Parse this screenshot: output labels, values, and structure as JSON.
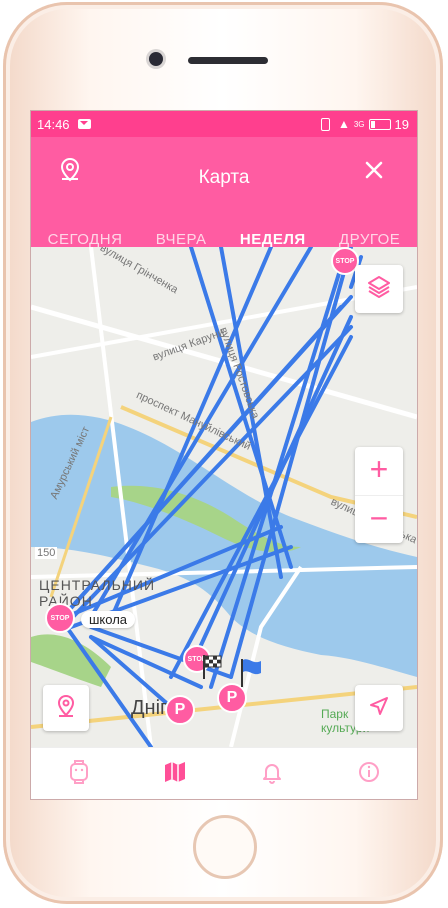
{
  "status_bar": {
    "time": "14:46",
    "battery": "19",
    "network": "3G"
  },
  "header": {
    "title": "Карта"
  },
  "tabs": [
    {
      "label": "СЕГОДНЯ",
      "active": false
    },
    {
      "label": "ВЧЕРА",
      "active": false
    },
    {
      "label": "НЕДЕЛЯ",
      "active": true
    },
    {
      "label": "ДРУГОЕ",
      "active": false
    }
  ],
  "map": {
    "labels": {
      "street1": "вулиця Грінченка",
      "street2": "вулиця Каруни",
      "street3": "вулиця Ростовська",
      "avenue": "проспект Мануйлівський",
      "street4": "вулиця Собарська",
      "bridge": "Амурський міст",
      "district": "ЦЕНТРАЛЬНИЙ РАЙОН",
      "city": "Дніпро",
      "park": "Парк культури",
      "road": "150"
    },
    "place_label": "школа",
    "markers": {
      "stop": "STOP",
      "parking": "P"
    },
    "controls": {
      "zoom_in": "+",
      "zoom_out": "−"
    }
  },
  "colors": {
    "primary": "#ff5ca2",
    "status": "#ff3f8e",
    "route": "#3b7ae8",
    "water": "#9dc9ec"
  },
  "bottom_nav": [
    {
      "icon": "watch-icon",
      "active": false
    },
    {
      "icon": "map-icon",
      "active": true
    },
    {
      "icon": "bell-icon",
      "active": false
    },
    {
      "icon": "info-icon",
      "active": false
    }
  ]
}
